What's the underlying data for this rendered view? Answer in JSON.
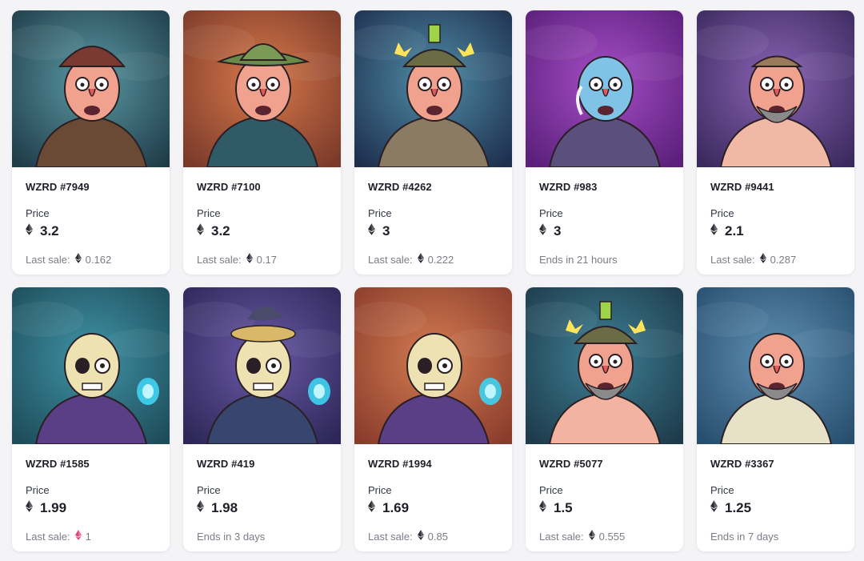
{
  "labels": {
    "price": "Price",
    "last_sale": "Last sale:"
  },
  "currency_icon": "ethereum-icon",
  "cards": [
    {
      "name": "WZRD #7949",
      "price": "3.2",
      "footer": {
        "type": "sale",
        "value": "0.162",
        "eth_color": "#2b2b35"
      },
      "bg": [
        "#1f3c4a",
        "#5b9aa3"
      ],
      "char": "hat-red"
    },
    {
      "name": "WZRD #7100",
      "price": "3.2",
      "footer": {
        "type": "sale",
        "value": "0.17",
        "eth_color": "#2b2b35"
      },
      "bg": [
        "#7a3a2a",
        "#d9794a"
      ],
      "char": "hat-green"
    },
    {
      "name": "WZRD #4262",
      "price": "3",
      "footer": {
        "type": "sale",
        "value": "0.222",
        "eth_color": "#2b2b35"
      },
      "bg": [
        "#1e2f4e",
        "#4f8ea8"
      ],
      "char": "helmet"
    },
    {
      "name": "WZRD #983",
      "price": "3",
      "footer": {
        "type": "ends",
        "text": "Ends in 21 hours"
      },
      "bg": [
        "#5a1f7a",
        "#a64ec7"
      ],
      "char": "blue"
    },
    {
      "name": "WZRD #9441",
      "price": "2.1",
      "footer": {
        "type": "sale",
        "value": "0.287",
        "eth_color": "#2b2b35"
      },
      "bg": [
        "#3b2a5e",
        "#8a63b4"
      ],
      "char": "bald-cap"
    },
    {
      "name": "WZRD #1585",
      "price": "1.99",
      "footer": {
        "type": "sale",
        "value": "1",
        "eth_color": "#e0407a"
      },
      "bg": [
        "#1e4c5a",
        "#3f94a6"
      ],
      "char": "skull"
    },
    {
      "name": "WZRD #419",
      "price": "1.98",
      "footer": {
        "type": "ends",
        "text": "Ends in 3 days"
      },
      "bg": [
        "#2d2757",
        "#6a5aa8"
      ],
      "char": "skull-nest"
    },
    {
      "name": "WZRD #1994",
      "price": "1.69",
      "footer": {
        "type": "sale",
        "value": "0.85",
        "eth_color": "#2b2b35"
      },
      "bg": [
        "#8a3c2c",
        "#d47d52"
      ],
      "char": "skull"
    },
    {
      "name": "WZRD #5077",
      "price": "1.5",
      "footer": {
        "type": "sale",
        "value": "0.555",
        "eth_color": "#2b2b35"
      },
      "bg": [
        "#1d3b4a",
        "#3f8097"
      ],
      "char": "helmet-grey"
    },
    {
      "name": "WZRD #3367",
      "price": "1.25",
      "footer": {
        "type": "ends",
        "text": "Ends in 7 days"
      },
      "bg": [
        "#284e6e",
        "#5f90b4"
      ],
      "char": "bald"
    }
  ]
}
